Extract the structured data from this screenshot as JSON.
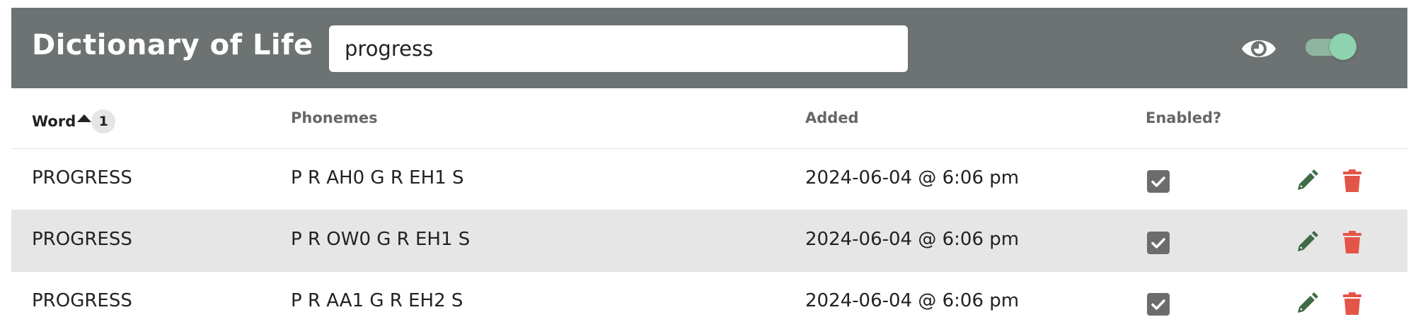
{
  "app": {
    "title": "Dictionary of Life"
  },
  "search": {
    "value": "progress",
    "placeholder": ""
  },
  "header_controls": {
    "visibility_icon": "eye-icon",
    "toggle_state": "on",
    "toggle_color": "#8dd3b0"
  },
  "table": {
    "columns": {
      "word": "Word",
      "phonemes": "Phonemes",
      "added": "Added",
      "enabled": "Enabled?"
    },
    "sort": {
      "column": "word",
      "direction": "ascending",
      "priority": "1"
    },
    "rows": [
      {
        "word": "PROGRESS",
        "phonemes": "P R AH0 G R EH1 S",
        "added": "2024-06-04 @ 6:06 pm",
        "enabled": true
      },
      {
        "word": "PROGRESS",
        "phonemes": "P R OW0 G R EH1 S",
        "added": "2024-06-04 @ 6:06 pm",
        "enabled": true
      },
      {
        "word": "PROGRESS",
        "phonemes": "P R AA1 G R EH2 S",
        "added": "2024-06-04 @ 6:06 pm",
        "enabled": true
      }
    ]
  },
  "colors": {
    "header_bg": "#6d7372",
    "edit": "#3f6b45",
    "delete": "#e35546",
    "checkbox": "#6c6c6c",
    "row_alt": "#e6e6e6"
  },
  "icons": {
    "edit": "pencil-icon",
    "delete": "trash-icon",
    "checked": "checkmark-icon"
  }
}
